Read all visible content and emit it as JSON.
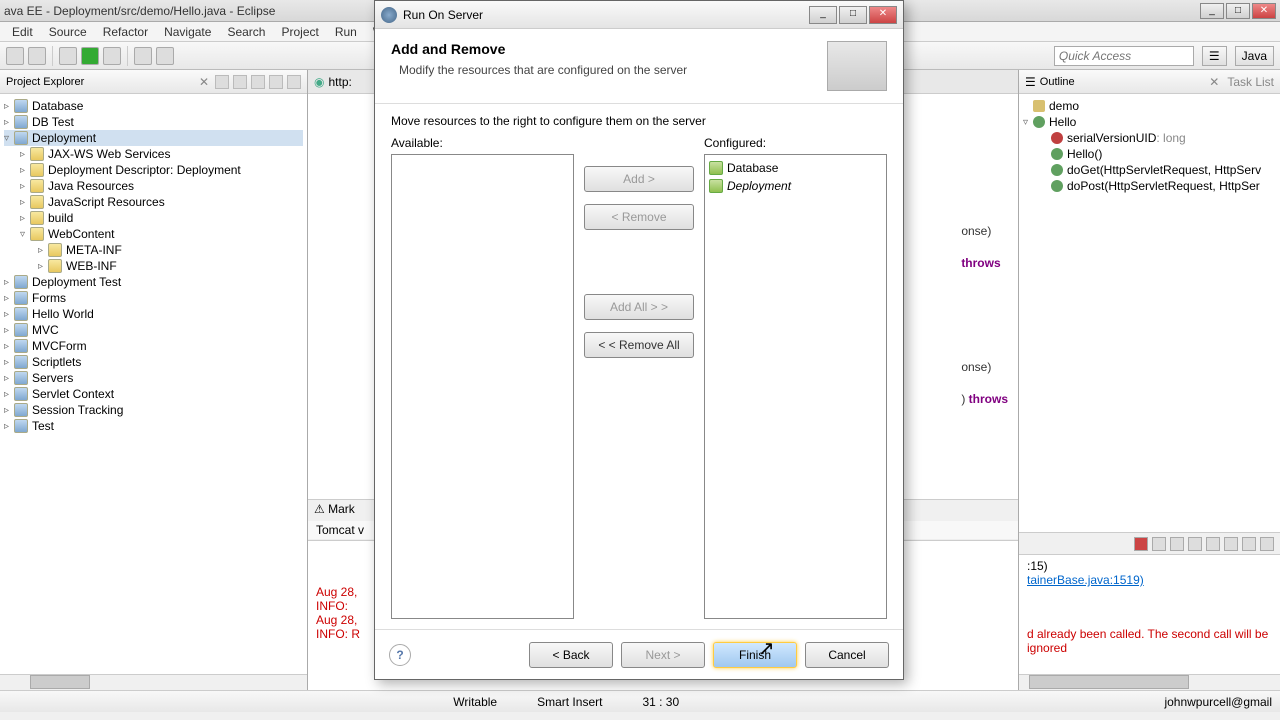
{
  "window": {
    "title": "ava EE - Deployment/src/demo/Hello.java - Eclipse"
  },
  "menu": [
    "Edit",
    "Source",
    "Refactor",
    "Navigate",
    "Search",
    "Project",
    "Run",
    "Wind"
  ],
  "quickAccess": {
    "placeholder": "Quick Access"
  },
  "perspective": "Java",
  "leftPanel": {
    "title": "Project Explorer",
    "tree": [
      {
        "label": "Database",
        "depth": 0,
        "expand": "▹",
        "icon": "proj"
      },
      {
        "label": "DB Test",
        "depth": 0,
        "expand": "▹",
        "icon": "proj"
      },
      {
        "label": "Deployment",
        "depth": 0,
        "expand": "▿",
        "icon": "proj",
        "sel": true
      },
      {
        "label": "JAX-WS Web Services",
        "depth": 1,
        "expand": "▹",
        "icon": "folder"
      },
      {
        "label": "Deployment Descriptor: Deployment",
        "depth": 1,
        "expand": "▹",
        "icon": "folder"
      },
      {
        "label": "Java Resources",
        "depth": 1,
        "expand": "▹",
        "icon": "folder"
      },
      {
        "label": "JavaScript Resources",
        "depth": 1,
        "expand": "▹",
        "icon": "folder"
      },
      {
        "label": "build",
        "depth": 1,
        "expand": "▹",
        "icon": "folder"
      },
      {
        "label": "WebContent",
        "depth": 1,
        "expand": "▿",
        "icon": "folder"
      },
      {
        "label": "META-INF",
        "depth": 2,
        "expand": "▹",
        "icon": "folder"
      },
      {
        "label": "WEB-INF",
        "depth": 2,
        "expand": "▹",
        "icon": "folder"
      },
      {
        "label": "Deployment Test",
        "depth": 0,
        "expand": "▹",
        "icon": "proj"
      },
      {
        "label": "Forms",
        "depth": 0,
        "expand": "▹",
        "icon": "proj"
      },
      {
        "label": "Hello World",
        "depth": 0,
        "expand": "▹",
        "icon": "proj"
      },
      {
        "label": "MVC",
        "depth": 0,
        "expand": "▹",
        "icon": "proj"
      },
      {
        "label": "MVCForm",
        "depth": 0,
        "expand": "▹",
        "icon": "proj"
      },
      {
        "label": "Scriptlets",
        "depth": 0,
        "expand": "▹",
        "icon": "proj"
      },
      {
        "label": "Servers",
        "depth": 0,
        "expand": "▹",
        "icon": "proj"
      },
      {
        "label": "Servlet Context",
        "depth": 0,
        "expand": "▹",
        "icon": "proj"
      },
      {
        "label": "Session Tracking",
        "depth": 0,
        "expand": "▹",
        "icon": "proj"
      },
      {
        "label": "Test",
        "depth": 0,
        "expand": "▹",
        "icon": "proj"
      }
    ]
  },
  "editor": {
    "tabPrefix": "http:",
    "code": {
      "l1": "onse)",
      "l2": "throws",
      "l3": "onse)",
      "l4": "throws"
    }
  },
  "markersTab": "Mark",
  "consoleHeader": "Tomcat v",
  "consoleLines": [
    {
      "cls": "err",
      "text": "Aug 28,"
    },
    {
      "cls": "err",
      "text": "INFO:"
    },
    {
      "cls": "err",
      "text": "Aug 28,"
    },
    {
      "cls": "err",
      "text": "INFO: R"
    }
  ],
  "consoleRight": {
    "l1": ":15)",
    "l2": "tainerBase.java:1519)",
    "l3": "d already been called. The second call will be ignored"
  },
  "rightPanel": {
    "tabs": [
      "Outline",
      "Task List"
    ],
    "outline": [
      {
        "label": "demo",
        "depth": 0,
        "icon": "pkg"
      },
      {
        "label": "Hello",
        "depth": 0,
        "icon": "cls",
        "expand": "▿"
      },
      {
        "label": "serialVersionUID",
        "type": ": long",
        "depth": 1,
        "icon": "fld"
      },
      {
        "label": "Hello()",
        "depth": 1,
        "icon": "meth"
      },
      {
        "label": "doGet(HttpServletRequest, HttpServ",
        "depth": 1,
        "icon": "meth"
      },
      {
        "label": "doPost(HttpServletRequest, HttpSer",
        "depth": 1,
        "icon": "meth"
      }
    ]
  },
  "status": {
    "writable": "Writable",
    "mode": "Smart Insert",
    "pos": "31 : 30",
    "user": "johnwpurcell@gmail"
  },
  "dialog": {
    "title": "Run On Server",
    "heading": "Add and Remove",
    "sub": "Modify the resources that are configured on the server",
    "instruction": "Move resources to the right to configure them on the server",
    "availableLabel": "Available:",
    "configuredLabel": "Configured:",
    "configured": [
      {
        "label": "Database",
        "italic": false
      },
      {
        "label": "Deployment",
        "italic": true
      }
    ],
    "btns": {
      "add": "Add >",
      "remove": "< Remove",
      "addAll": "Add All > >",
      "removeAll": "< < Remove All"
    },
    "footer": {
      "back": "< Back",
      "next": "Next >",
      "finish": "Finish",
      "cancel": "Cancel"
    }
  }
}
